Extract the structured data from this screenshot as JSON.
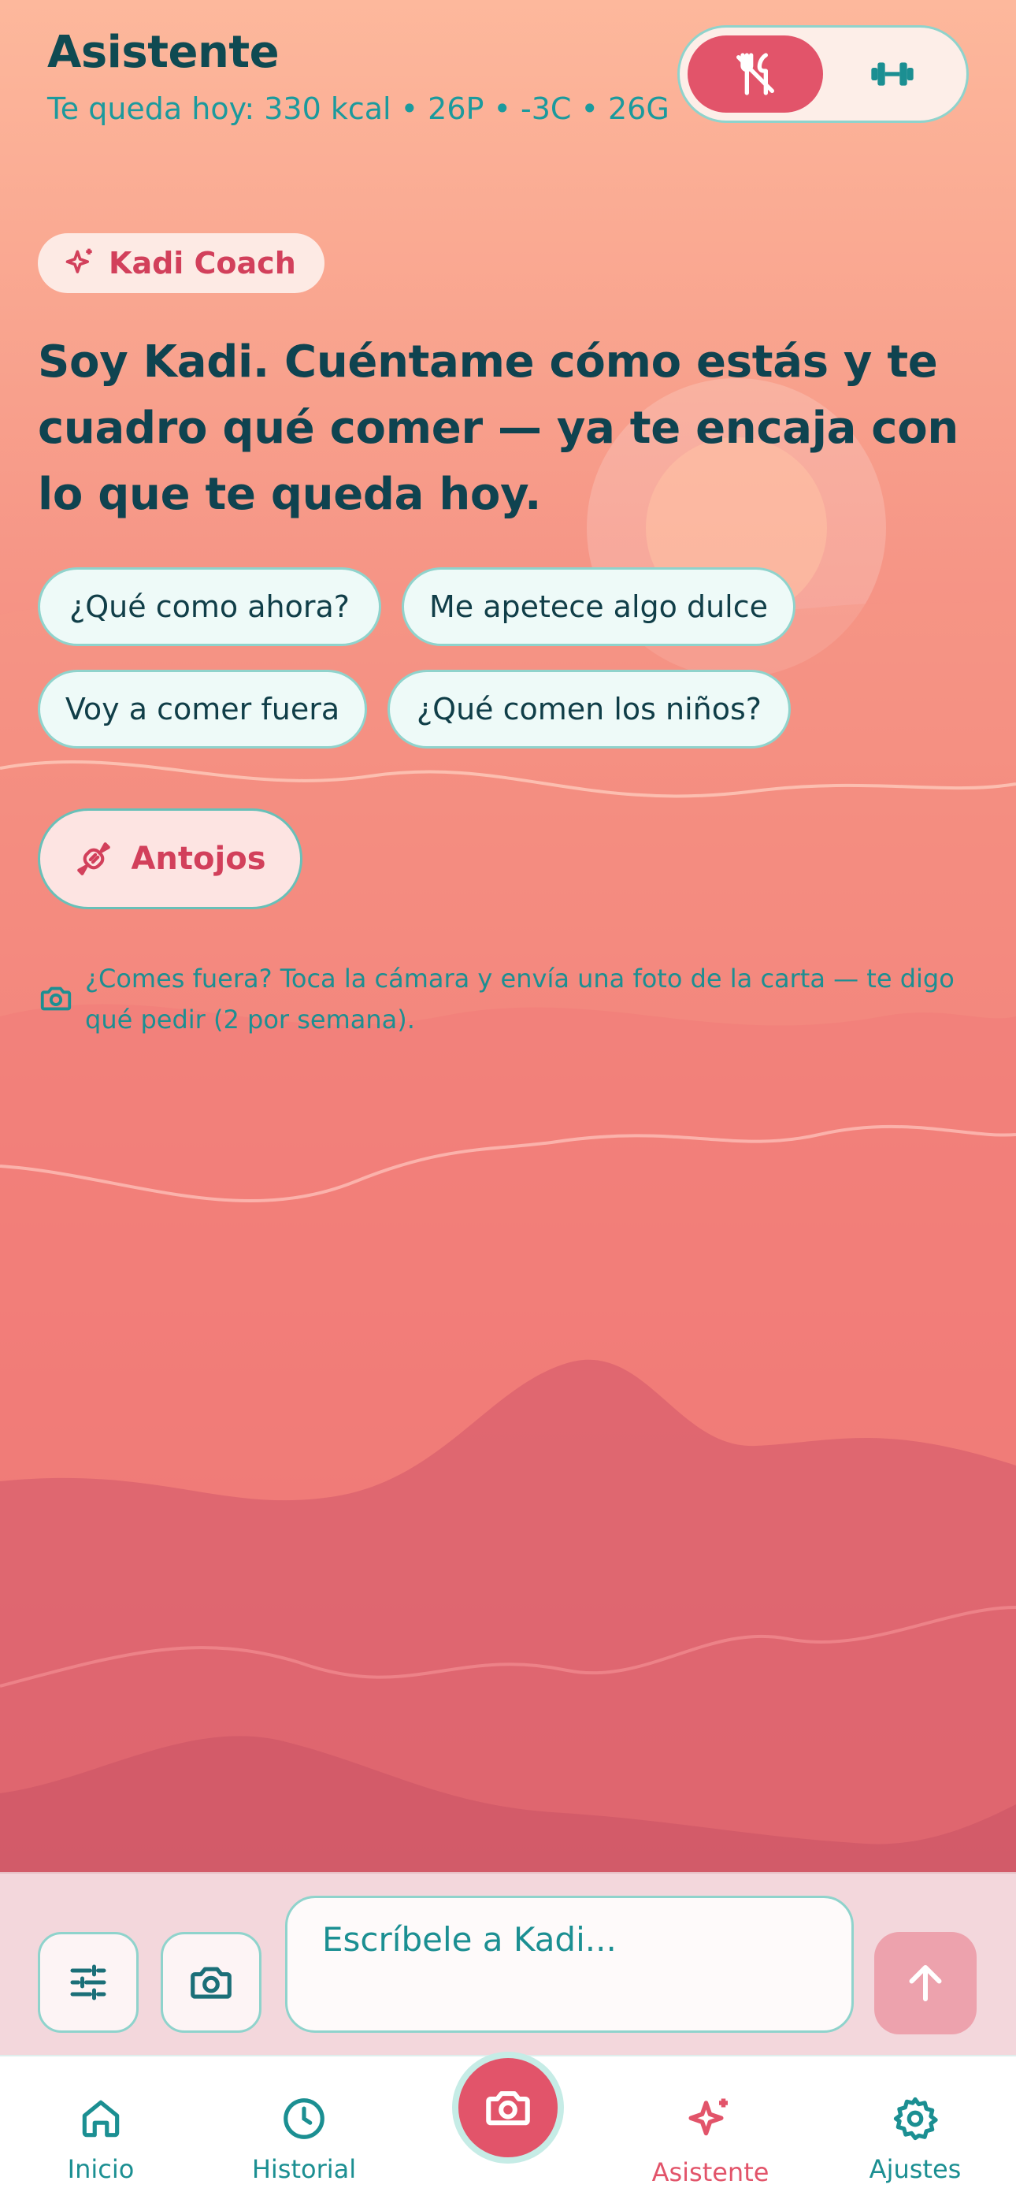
{
  "header": {
    "title": "Asistente",
    "remaining": "Te queda hoy: 330 kcal • 26P • -3C • 26G",
    "mode_toggle": {
      "options": [
        "fork-knife-icon",
        "dumbbell-icon"
      ],
      "selected": "fork-knife-icon"
    }
  },
  "coach_badge": {
    "label": "Kadi Coach",
    "icon": "sparkle-icon"
  },
  "intro_message": "Soy Kadi. Cuéntame cómo estás y te cuadro qué comer — ya te encaja con lo que te queda hoy.",
  "suggestions": [
    "¿Qué como ahora?",
    "Me apetece algo dulce",
    "Voy a comer fuera",
    "¿Qué comen los niños?"
  ],
  "antojos": {
    "label": "Antojos",
    "icon": "candy-icon"
  },
  "photo_hint": "¿Comes fuera? Toca la cámara y envía una foto de la carta — te digo qué pedir (2 por semana).",
  "composer": {
    "placeholder": "Escríbele a Kadi...",
    "value": ""
  },
  "tabs": [
    {
      "label": "Inicio",
      "icon": "home-icon"
    },
    {
      "label": "Historial",
      "icon": "clock-icon"
    },
    {
      "label": "Asistente",
      "icon": "sparkle-icon",
      "active": true
    },
    {
      "label": "Ajustes",
      "icon": "gear-icon"
    }
  ],
  "colors": {
    "accent": "#e2546a",
    "teal": "#1b9a9d",
    "dark_text": "#0f4a52"
  }
}
